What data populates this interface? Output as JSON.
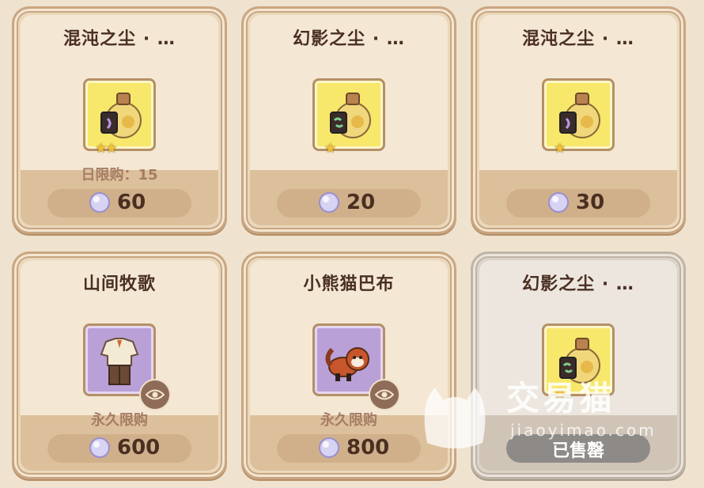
{
  "cards": [
    {
      "title": "混沌之尘 · …",
      "limit": "日限购：15",
      "price": "60",
      "icon": "potion-chaos-icon",
      "stars": "★★"
    },
    {
      "title": "幻影之尘 · …",
      "limit": "",
      "price": "20",
      "icon": "potion-phantom-icon",
      "stars": "★"
    },
    {
      "title": "混沌之尘 · …",
      "limit": "",
      "price": "30",
      "icon": "potion-chaos-icon",
      "stars": "★"
    },
    {
      "title": "山间牧歌",
      "limit": "永久限购",
      "price": "600",
      "icon": "outfit-icon",
      "stars": ""
    },
    {
      "title": "小熊猫巴布",
      "limit": "永久限购",
      "price": "800",
      "icon": "red-panda-icon",
      "stars": ""
    },
    {
      "title": "幻影之尘 · …",
      "limit": "",
      "price": "",
      "sold_label": "已售罄",
      "icon": "potion-phantom-icon",
      "stars": "★"
    }
  ],
  "watermark": {
    "text": "交易猫",
    "url": "jiaoyimao.com"
  },
  "colors": {
    "accent_text": "#4a2f22",
    "limit_text": "#a67c64",
    "gem": "#c9c3ee"
  }
}
